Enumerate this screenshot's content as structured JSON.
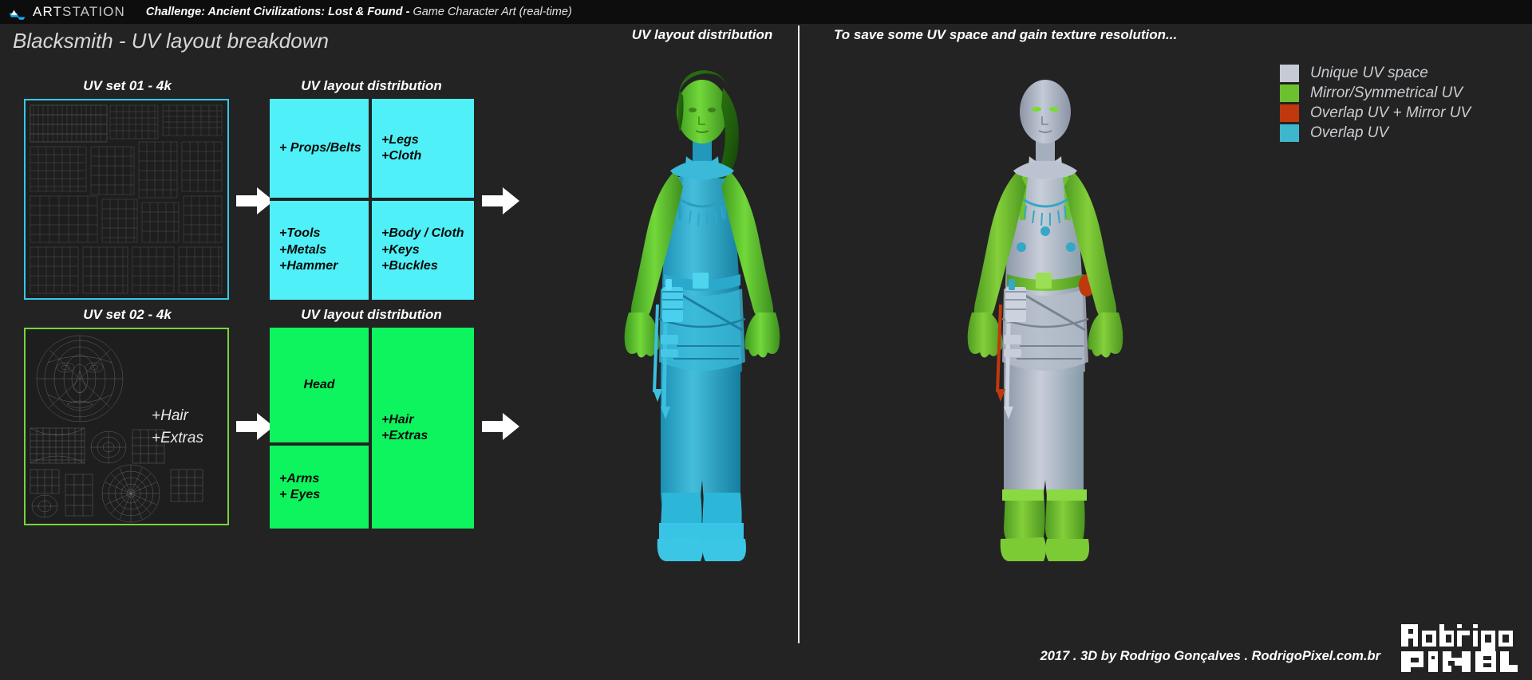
{
  "topbar": {
    "brand_primary": "ART",
    "brand_secondary": "STATION",
    "challenge_label": "Challenge: Ancient Civilizations: Lost & Found -",
    "challenge_sub": " Game Character Art (real-time)",
    "logo_icon": "artstation-logo-icon"
  },
  "page_title": "Blacksmith - UV layout breakdown",
  "colors": {
    "background": "#232323",
    "cyan_uv": "#4ff0f7",
    "green_uv": "#0ef45e",
    "sheet_cyan_border": "#35c8e8",
    "sheet_green_border": "#77d43a",
    "legend_unique": "#c5cbd4",
    "legend_mirror": "#6cc130",
    "legend_overlap_mirror": "#c0380d",
    "legend_overlap": "#3fb6cc"
  },
  "uv_set_01": {
    "title": "UV set 01 - 4k",
    "distribution_title": "UV layout distribution",
    "cells": [
      {
        "id": "props-belts",
        "text": "+ Props/Belts"
      },
      {
        "id": "legs-cloth",
        "text": "+Legs\n+Cloth"
      },
      {
        "id": "tools-metals-hammer",
        "text": "+Tools\n+Metals\n+Hammer"
      },
      {
        "id": "body-cloth-keys-buckles",
        "text": "+Body / Cloth\n+Keys\n+Buckles"
      }
    ]
  },
  "uv_set_02": {
    "title": "UV set 02 - 4k",
    "distribution_title": "UV layout distribution",
    "sheet_note": "+Hair\n+Extras",
    "cells": [
      {
        "id": "head",
        "text": "Head"
      },
      {
        "id": "hair-extras",
        "text": "+Hair\n+Extras"
      },
      {
        "id": "arms-eyes",
        "text": "+Arms\n+ Eyes"
      }
    ]
  },
  "center": {
    "title": "UV layout distribution"
  },
  "right": {
    "title": "To save some UV space and gain texture resolution...",
    "legend": [
      {
        "label": "Unique UV space",
        "color": "#c5cbd4"
      },
      {
        "label": "Mirror/Symmetrical UV",
        "color": "#6cc130"
      },
      {
        "label": "Overlap UV + Mirror UV",
        "color": "#c0380d"
      },
      {
        "label": "Overlap UV",
        "color": "#3fb6cc"
      }
    ]
  },
  "footer": {
    "credit": "2017 . 3D by Rodrigo Gonçalves . RodrigoPixel.com.br",
    "logo_line1": "Rodrigo",
    "logo_line2": "PIXEL"
  }
}
